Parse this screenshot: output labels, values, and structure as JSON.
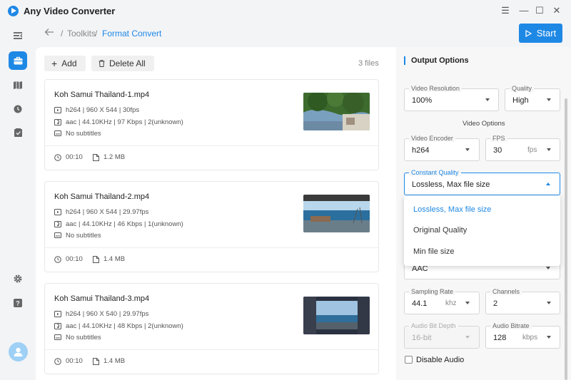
{
  "app": {
    "title": "Any Video Converter"
  },
  "topbar": {
    "breadcrumb": [
      "Toolkits",
      "Format Convert"
    ],
    "start_label": "Start"
  },
  "toolbar": {
    "add_label": "Add",
    "delete_all_label": "Delete All",
    "file_count": "3 files"
  },
  "files": [
    {
      "name": "Koh Samui Thailand-1.mp4",
      "video": "h264 | 960 X 544 | 30fps",
      "audio": "aac | 44.10KHz | 97 Kbps | 2(unknown)",
      "subtitles": "No subtitles",
      "duration": "00:10",
      "size": "1.2 MB"
    },
    {
      "name": "Koh Samui Thailand-2.mp4",
      "video": "h264 | 960 X 544 | 29.97fps",
      "audio": "aac | 44.10KHz | 46 Kbps | 1(unknown)",
      "subtitles": "No subtitles",
      "duration": "00:10",
      "size": "1.4 MB"
    },
    {
      "name": "Koh Samui Thailand-3.mp4",
      "video": "h264 | 960 X 540 | 29.97fps",
      "audio": "aac | 44.10KHz | 48 Kbps | 2(unknown)",
      "subtitles": "No subtitles",
      "duration": "00:10",
      "size": "1.4 MB"
    }
  ],
  "output": {
    "title": "Output Options",
    "video_resolution": {
      "label": "Video Resolution",
      "value": "100%"
    },
    "quality": {
      "label": "Quality",
      "value": "High"
    },
    "video_options_title": "Video Options",
    "video_encoder": {
      "label": "Video Encoder",
      "value": "h264"
    },
    "fps": {
      "label": "FPS",
      "value": "30",
      "unit": "fps"
    },
    "constant_quality": {
      "label": "Constant Quality",
      "value": "Lossless, Max file size",
      "options": [
        "Lossless, Max file size",
        "Original Quality",
        "Min file size"
      ]
    },
    "audio_encoder": {
      "value": "AAC"
    },
    "sampling_rate": {
      "label": "Sampling Rate",
      "value": "44.1",
      "unit": "khz"
    },
    "channels": {
      "label": "Channels",
      "value": "2"
    },
    "audio_bit_depth": {
      "label": "Audio Bit Depth",
      "value": "16-bit"
    },
    "audio_bitrate": {
      "label": "Audio Bitrate",
      "value": "128",
      "unit": "kbps"
    },
    "disable_audio_label": "Disable Audio"
  },
  "colors": {
    "accent": "#1e88e5"
  }
}
